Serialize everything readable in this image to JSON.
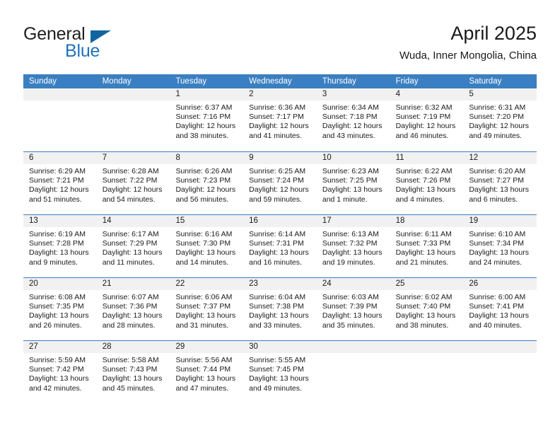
{
  "brand": {
    "name_part1": "General",
    "name_part2": "Blue",
    "logo_icon": "triangle-icon",
    "accent_color": "#11659f",
    "blue_text_color": "#1f72bd"
  },
  "header": {
    "title": "April 2025",
    "location": "Wuda, Inner Mongolia, China"
  },
  "calendar": {
    "header_bg": "#3a7fc1",
    "datebar_bg": "#f1f1f1",
    "weekdays": [
      "Sunday",
      "Monday",
      "Tuesday",
      "Wednesday",
      "Thursday",
      "Friday",
      "Saturday"
    ],
    "weeks": [
      [
        {
          "day": "",
          "sunrise": "",
          "sunset": "",
          "daylight1": "",
          "daylight2": ""
        },
        {
          "day": "",
          "sunrise": "",
          "sunset": "",
          "daylight1": "",
          "daylight2": ""
        },
        {
          "day": "1",
          "sunrise": "Sunrise: 6:37 AM",
          "sunset": "Sunset: 7:16 PM",
          "daylight1": "Daylight: 12 hours",
          "daylight2": "and 38 minutes."
        },
        {
          "day": "2",
          "sunrise": "Sunrise: 6:36 AM",
          "sunset": "Sunset: 7:17 PM",
          "daylight1": "Daylight: 12 hours",
          "daylight2": "and 41 minutes."
        },
        {
          "day": "3",
          "sunrise": "Sunrise: 6:34 AM",
          "sunset": "Sunset: 7:18 PM",
          "daylight1": "Daylight: 12 hours",
          "daylight2": "and 43 minutes."
        },
        {
          "day": "4",
          "sunrise": "Sunrise: 6:32 AM",
          "sunset": "Sunset: 7:19 PM",
          "daylight1": "Daylight: 12 hours",
          "daylight2": "and 46 minutes."
        },
        {
          "day": "5",
          "sunrise": "Sunrise: 6:31 AM",
          "sunset": "Sunset: 7:20 PM",
          "daylight1": "Daylight: 12 hours",
          "daylight2": "and 49 minutes."
        }
      ],
      [
        {
          "day": "6",
          "sunrise": "Sunrise: 6:29 AM",
          "sunset": "Sunset: 7:21 PM",
          "daylight1": "Daylight: 12 hours",
          "daylight2": "and 51 minutes."
        },
        {
          "day": "7",
          "sunrise": "Sunrise: 6:28 AM",
          "sunset": "Sunset: 7:22 PM",
          "daylight1": "Daylight: 12 hours",
          "daylight2": "and 54 minutes."
        },
        {
          "day": "8",
          "sunrise": "Sunrise: 6:26 AM",
          "sunset": "Sunset: 7:23 PM",
          "daylight1": "Daylight: 12 hours",
          "daylight2": "and 56 minutes."
        },
        {
          "day": "9",
          "sunrise": "Sunrise: 6:25 AM",
          "sunset": "Sunset: 7:24 PM",
          "daylight1": "Daylight: 12 hours",
          "daylight2": "and 59 minutes."
        },
        {
          "day": "10",
          "sunrise": "Sunrise: 6:23 AM",
          "sunset": "Sunset: 7:25 PM",
          "daylight1": "Daylight: 13 hours",
          "daylight2": "and 1 minute."
        },
        {
          "day": "11",
          "sunrise": "Sunrise: 6:22 AM",
          "sunset": "Sunset: 7:26 PM",
          "daylight1": "Daylight: 13 hours",
          "daylight2": "and 4 minutes."
        },
        {
          "day": "12",
          "sunrise": "Sunrise: 6:20 AM",
          "sunset": "Sunset: 7:27 PM",
          "daylight1": "Daylight: 13 hours",
          "daylight2": "and 6 minutes."
        }
      ],
      [
        {
          "day": "13",
          "sunrise": "Sunrise: 6:19 AM",
          "sunset": "Sunset: 7:28 PM",
          "daylight1": "Daylight: 13 hours",
          "daylight2": "and 9 minutes."
        },
        {
          "day": "14",
          "sunrise": "Sunrise: 6:17 AM",
          "sunset": "Sunset: 7:29 PM",
          "daylight1": "Daylight: 13 hours",
          "daylight2": "and 11 minutes."
        },
        {
          "day": "15",
          "sunrise": "Sunrise: 6:16 AM",
          "sunset": "Sunset: 7:30 PM",
          "daylight1": "Daylight: 13 hours",
          "daylight2": "and 14 minutes."
        },
        {
          "day": "16",
          "sunrise": "Sunrise: 6:14 AM",
          "sunset": "Sunset: 7:31 PM",
          "daylight1": "Daylight: 13 hours",
          "daylight2": "and 16 minutes."
        },
        {
          "day": "17",
          "sunrise": "Sunrise: 6:13 AM",
          "sunset": "Sunset: 7:32 PM",
          "daylight1": "Daylight: 13 hours",
          "daylight2": "and 19 minutes."
        },
        {
          "day": "18",
          "sunrise": "Sunrise: 6:11 AM",
          "sunset": "Sunset: 7:33 PM",
          "daylight1": "Daylight: 13 hours",
          "daylight2": "and 21 minutes."
        },
        {
          "day": "19",
          "sunrise": "Sunrise: 6:10 AM",
          "sunset": "Sunset: 7:34 PM",
          "daylight1": "Daylight: 13 hours",
          "daylight2": "and 24 minutes."
        }
      ],
      [
        {
          "day": "20",
          "sunrise": "Sunrise: 6:08 AM",
          "sunset": "Sunset: 7:35 PM",
          "daylight1": "Daylight: 13 hours",
          "daylight2": "and 26 minutes."
        },
        {
          "day": "21",
          "sunrise": "Sunrise: 6:07 AM",
          "sunset": "Sunset: 7:36 PM",
          "daylight1": "Daylight: 13 hours",
          "daylight2": "and 28 minutes."
        },
        {
          "day": "22",
          "sunrise": "Sunrise: 6:06 AM",
          "sunset": "Sunset: 7:37 PM",
          "daylight1": "Daylight: 13 hours",
          "daylight2": "and 31 minutes."
        },
        {
          "day": "23",
          "sunrise": "Sunrise: 6:04 AM",
          "sunset": "Sunset: 7:38 PM",
          "daylight1": "Daylight: 13 hours",
          "daylight2": "and 33 minutes."
        },
        {
          "day": "24",
          "sunrise": "Sunrise: 6:03 AM",
          "sunset": "Sunset: 7:39 PM",
          "daylight1": "Daylight: 13 hours",
          "daylight2": "and 35 minutes."
        },
        {
          "day": "25",
          "sunrise": "Sunrise: 6:02 AM",
          "sunset": "Sunset: 7:40 PM",
          "daylight1": "Daylight: 13 hours",
          "daylight2": "and 38 minutes."
        },
        {
          "day": "26",
          "sunrise": "Sunrise: 6:00 AM",
          "sunset": "Sunset: 7:41 PM",
          "daylight1": "Daylight: 13 hours",
          "daylight2": "and 40 minutes."
        }
      ],
      [
        {
          "day": "27",
          "sunrise": "Sunrise: 5:59 AM",
          "sunset": "Sunset: 7:42 PM",
          "daylight1": "Daylight: 13 hours",
          "daylight2": "and 42 minutes."
        },
        {
          "day": "28",
          "sunrise": "Sunrise: 5:58 AM",
          "sunset": "Sunset: 7:43 PM",
          "daylight1": "Daylight: 13 hours",
          "daylight2": "and 45 minutes."
        },
        {
          "day": "29",
          "sunrise": "Sunrise: 5:56 AM",
          "sunset": "Sunset: 7:44 PM",
          "daylight1": "Daylight: 13 hours",
          "daylight2": "and 47 minutes."
        },
        {
          "day": "30",
          "sunrise": "Sunrise: 5:55 AM",
          "sunset": "Sunset: 7:45 PM",
          "daylight1": "Daylight: 13 hours",
          "daylight2": "and 49 minutes."
        },
        {
          "day": "",
          "sunrise": "",
          "sunset": "",
          "daylight1": "",
          "daylight2": ""
        },
        {
          "day": "",
          "sunrise": "",
          "sunset": "",
          "daylight1": "",
          "daylight2": ""
        },
        {
          "day": "",
          "sunrise": "",
          "sunset": "",
          "daylight1": "",
          "daylight2": ""
        }
      ]
    ]
  }
}
